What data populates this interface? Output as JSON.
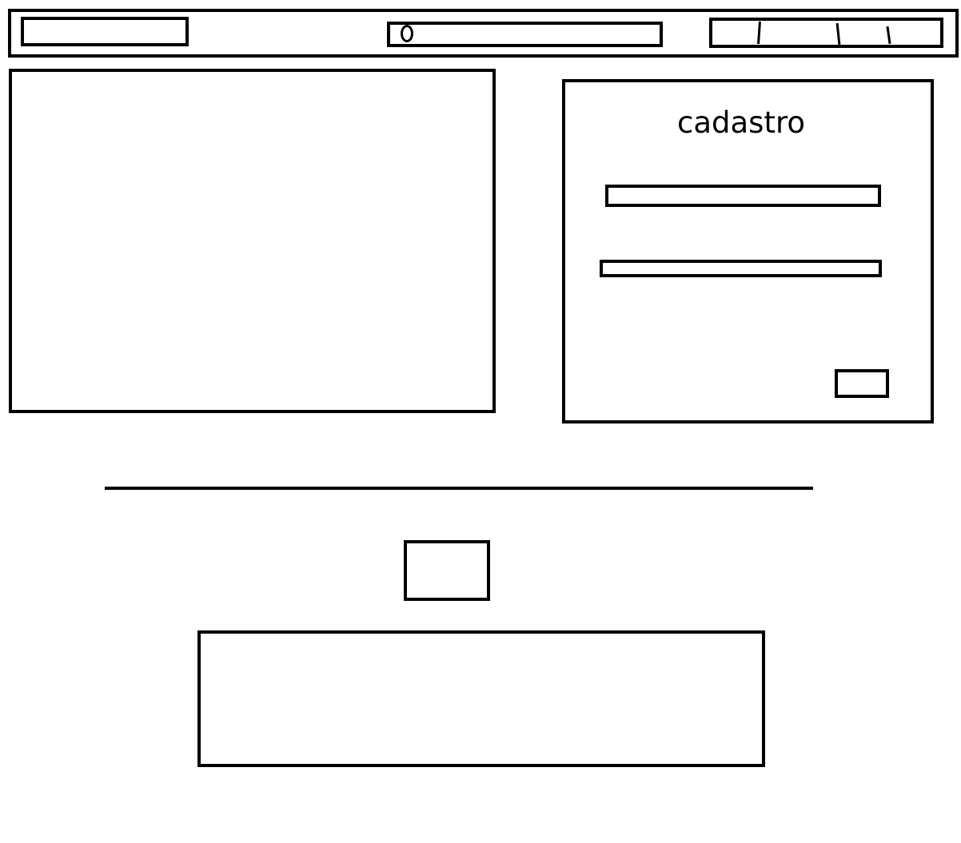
{
  "signup": {
    "title": "cadastro"
  }
}
